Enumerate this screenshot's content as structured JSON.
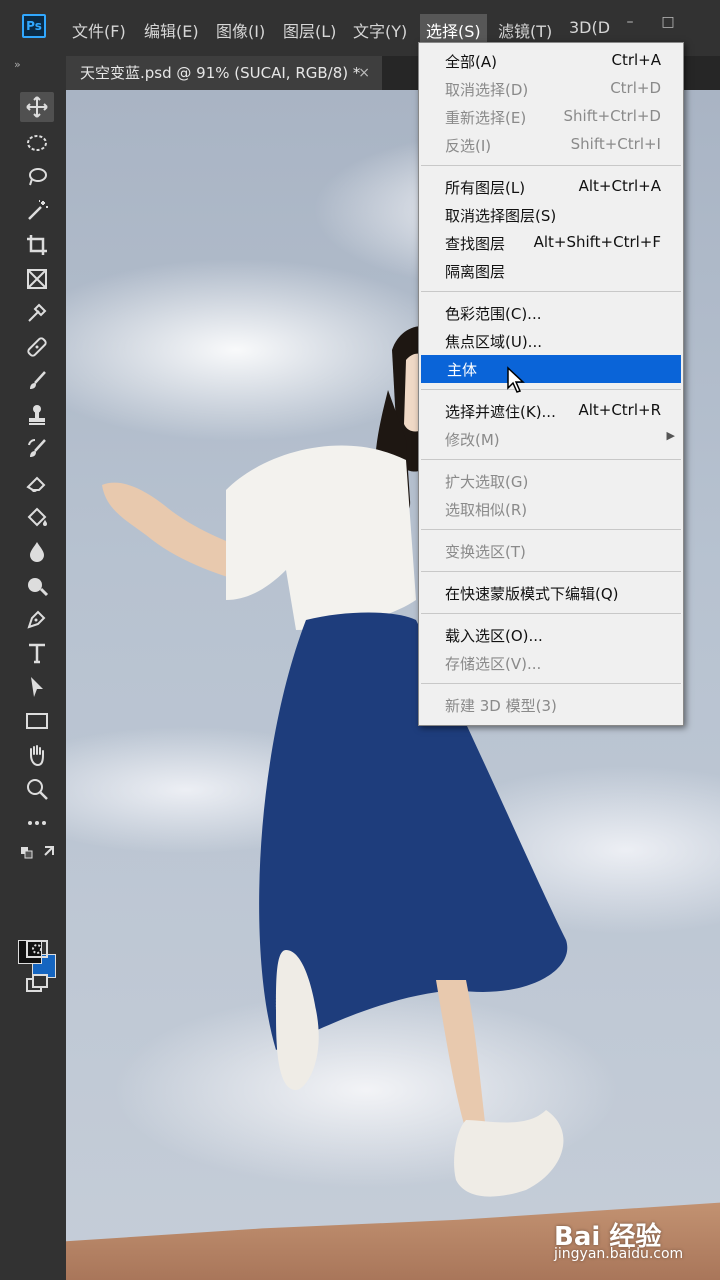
{
  "app": {
    "logo": "Ps"
  },
  "menubar": {
    "items": [
      "文件(F)",
      "编辑(E)",
      "图像(I)",
      "图层(L)",
      "文字(Y)",
      "选择(S)",
      "滤镜(T)",
      "3D(D"
    ],
    "window_buttons": [
      "–",
      "□"
    ]
  },
  "tab": {
    "title": "天空变蓝.psd @ 91% (SUCAI, RGB/8) *",
    "close": "×"
  },
  "toolbar": {
    "collapse": "»",
    "tools": [
      "move-tool-icon",
      "ellipse-marquee-icon",
      "lasso-icon",
      "magic-wand-icon",
      "crop-icon",
      "frame-icon",
      "eyedropper-icon",
      "healing-brush-icon",
      "brush-icon",
      "clone-stamp-icon",
      "history-brush-icon",
      "eraser-icon",
      "paint-bucket-icon",
      "blur-icon",
      "dodge-icon",
      "pen-icon",
      "type-icon",
      "path-selection-icon",
      "rectangle-icon",
      "hand-icon",
      "zoom-icon",
      "more-tools-icon"
    ],
    "foreground_color": "#111111",
    "background_color": "#1565c0"
  },
  "select_menu": {
    "groups": [
      [
        {
          "label": "全部(A)",
          "shortcut": "Ctrl+A",
          "disabled": false
        },
        {
          "label": "取消选择(D)",
          "shortcut": "Ctrl+D",
          "disabled": true
        },
        {
          "label": "重新选择(E)",
          "shortcut": "Shift+Ctrl+D",
          "disabled": true
        },
        {
          "label": "反选(I)",
          "shortcut": "Shift+Ctrl+I",
          "disabled": true
        }
      ],
      [
        {
          "label": "所有图层(L)",
          "shortcut": "Alt+Ctrl+A",
          "disabled": false
        },
        {
          "label": "取消选择图层(S)",
          "shortcut": "",
          "disabled": false
        },
        {
          "label": "查找图层",
          "shortcut": "Alt+Shift+Ctrl+F",
          "disabled": false
        },
        {
          "label": "隔离图层",
          "shortcut": "",
          "disabled": false
        }
      ],
      [
        {
          "label": "色彩范围(C)...",
          "shortcut": "",
          "disabled": false
        },
        {
          "label": "焦点区域(U)...",
          "shortcut": "",
          "disabled": false
        },
        {
          "label": "主体",
          "shortcut": "",
          "disabled": false,
          "highlighted": true
        }
      ],
      [
        {
          "label": "选择并遮住(K)...",
          "shortcut": "Alt+Ctrl+R",
          "disabled": false
        },
        {
          "label": "修改(M)",
          "shortcut": "",
          "disabled": true,
          "submenu": true
        }
      ],
      [
        {
          "label": "扩大选取(G)",
          "shortcut": "",
          "disabled": true
        },
        {
          "label": "选取相似(R)",
          "shortcut": "",
          "disabled": true
        }
      ],
      [
        {
          "label": "变换选区(T)",
          "shortcut": "",
          "disabled": true
        }
      ],
      [
        {
          "label": "在快速蒙版模式下编辑(Q)",
          "shortcut": "",
          "disabled": false
        }
      ],
      [
        {
          "label": "载入选区(O)...",
          "shortcut": "",
          "disabled": false
        },
        {
          "label": "存储选区(V)...",
          "shortcut": "",
          "disabled": true
        }
      ],
      [
        {
          "label": "新建 3D 模型(3)",
          "shortcut": "",
          "disabled": true
        }
      ]
    ]
  },
  "watermark": {
    "brand": "Bai 经验",
    "url": "jingyan.baidu.com"
  },
  "colors": {
    "highlight": "#0a64d8",
    "menubar": "#323232",
    "panel": "#262626"
  }
}
